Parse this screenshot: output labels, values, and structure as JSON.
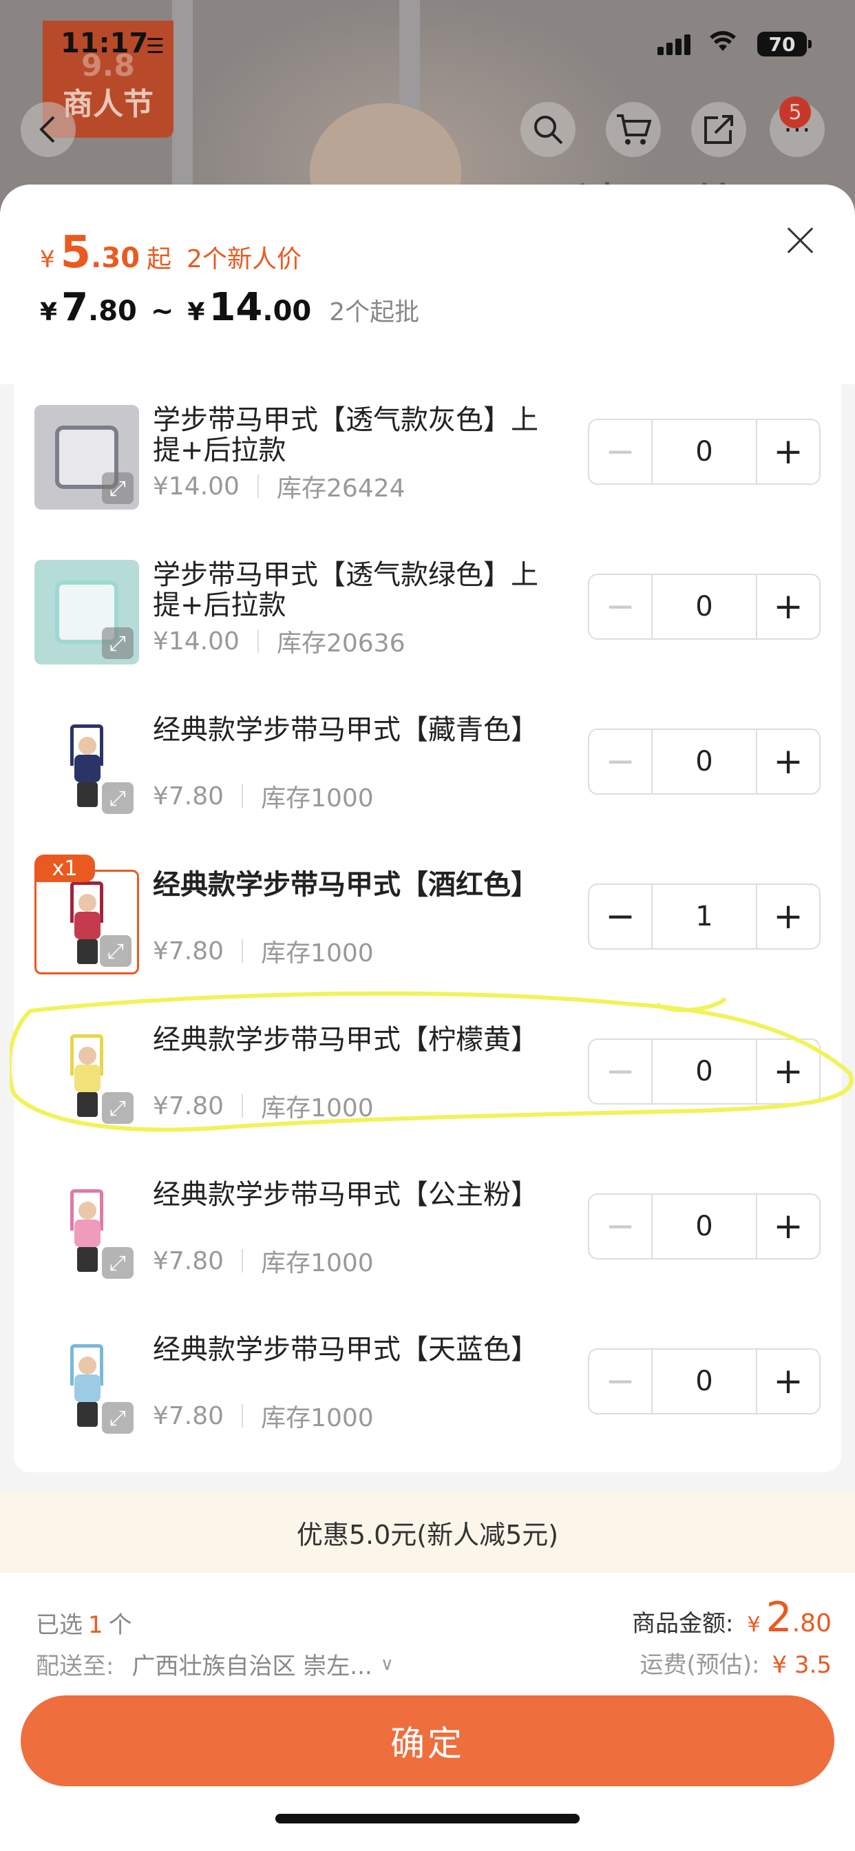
{
  "status_bar": {
    "time": "11:17",
    "battery": "70"
  },
  "background": {
    "promo_line1": "9.8",
    "promo_line2": "商人节",
    "cart_badge": "5",
    "title_fragment": "目科区什"
  },
  "header": {
    "low_price_int": "5",
    "low_price_dec": ".30",
    "low_price_suffix": "起",
    "new_user_price": "2个新人价",
    "range_min_int": "7",
    "range_min_dec": ".80",
    "range_sep": "~",
    "range_max_int": "14",
    "range_max_dec": ".00",
    "moq": "2个起批",
    "currency": "¥"
  },
  "items": [
    {
      "name": "学步带马甲式【透气款灰色】上提+后拉款",
      "price": "¥14.00",
      "stock": "库存26424",
      "qty": "0"
    },
    {
      "name": "学步带马甲式【透气款绿色】上提+后拉款",
      "price": "¥14.00",
      "stock": "库存20636",
      "qty": "0"
    },
    {
      "name": "经典款学步带马甲式【藏青色】",
      "price": "¥7.80",
      "stock": "库存1000",
      "qty": "0"
    },
    {
      "name": "经典款学步带马甲式【酒红色】",
      "price": "¥7.80",
      "stock": "库存1000",
      "qty": "1",
      "badge": "x1"
    },
    {
      "name": "经典款学步带马甲式【柠檬黄】",
      "price": "¥7.80",
      "stock": "库存1000",
      "qty": "0"
    },
    {
      "name": "经典款学步带马甲式【公主粉】",
      "price": "¥7.80",
      "stock": "库存1000",
      "qty": "0"
    },
    {
      "name": "经典款学步带马甲式【天蓝色】",
      "price": "¥7.80",
      "stock": "库存1000",
      "qty": "0"
    }
  ],
  "discount": "优惠5.0元(新人减5元)",
  "footer": {
    "selected_label": "已选",
    "selected_count": "1",
    "selected_unit": "个",
    "ship_label": "配送至:",
    "ship_addr": "广西壮族自治区 崇左...",
    "goods_label": "商品金额:",
    "goods_yen": "¥",
    "goods_int": "2",
    "goods_dec": ".80",
    "freight_label": "运费(预估):",
    "freight_val": "¥ 3.5",
    "confirm": "确定"
  },
  "colors": {
    "accent": "#ea5a20",
    "confirm": "#ee6e3e",
    "highlight": "#f2f25a"
  }
}
